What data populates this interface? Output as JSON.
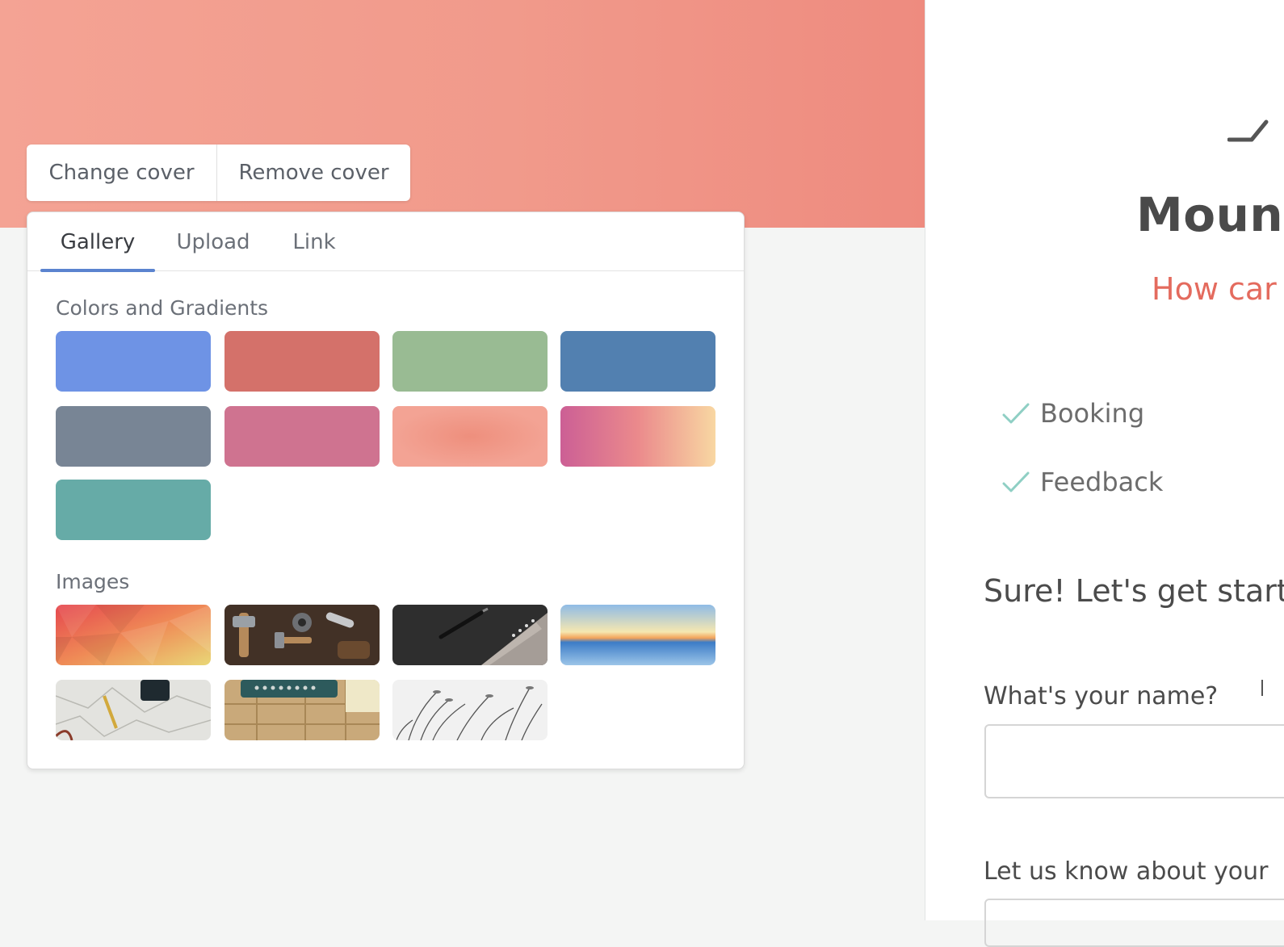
{
  "cover": {
    "change_label": "Change cover",
    "remove_label": "Remove cover",
    "tabs": [
      {
        "label": "Gallery",
        "active": true
      },
      {
        "label": "Upload",
        "active": false
      },
      {
        "label": "Link",
        "active": false
      }
    ],
    "colors_title": "Colors and Gradients",
    "images_title": "Images",
    "swatches": [
      {
        "name": "blue",
        "fill": "#6e93e5"
      },
      {
        "name": "red",
        "fill": "#d4716a"
      },
      {
        "name": "green",
        "fill": "#99bb93"
      },
      {
        "name": "steel-blue",
        "fill": "#5280b0"
      },
      {
        "name": "gray",
        "fill": "#788595"
      },
      {
        "name": "pink",
        "fill": "#cf7390"
      },
      {
        "name": "salmon-gradient",
        "fill": "radial-gradient(ellipse at center, #ee8f7d 0%, #f3a394 70%)"
      },
      {
        "name": "pink-peach-gradient",
        "fill": "linear-gradient(90deg, #cc5f95 0%, #eb8a8c 50%, #f8d7a2 100%)"
      },
      {
        "name": "teal",
        "fill": "#66aba7"
      }
    ],
    "images": [
      {
        "name": "low-poly-gradient"
      },
      {
        "name": "tools"
      },
      {
        "name": "notebook-pen"
      },
      {
        "name": "sunset-sea"
      },
      {
        "name": "map"
      },
      {
        "name": "typewriter"
      },
      {
        "name": "grass-sketch"
      }
    ]
  },
  "preview": {
    "title": "Moun",
    "subtitle": "How car",
    "options": [
      "Booking",
      "Feedback"
    ],
    "question_heading": "Sure! Let's get start",
    "name_label": "What's your name?",
    "about_label": "Let us know about your"
  },
  "colors": {
    "accent": "#5b83cf",
    "cover": "#f19a8b",
    "brand_red": "#e46b5e",
    "check": "#8fcfc4"
  }
}
